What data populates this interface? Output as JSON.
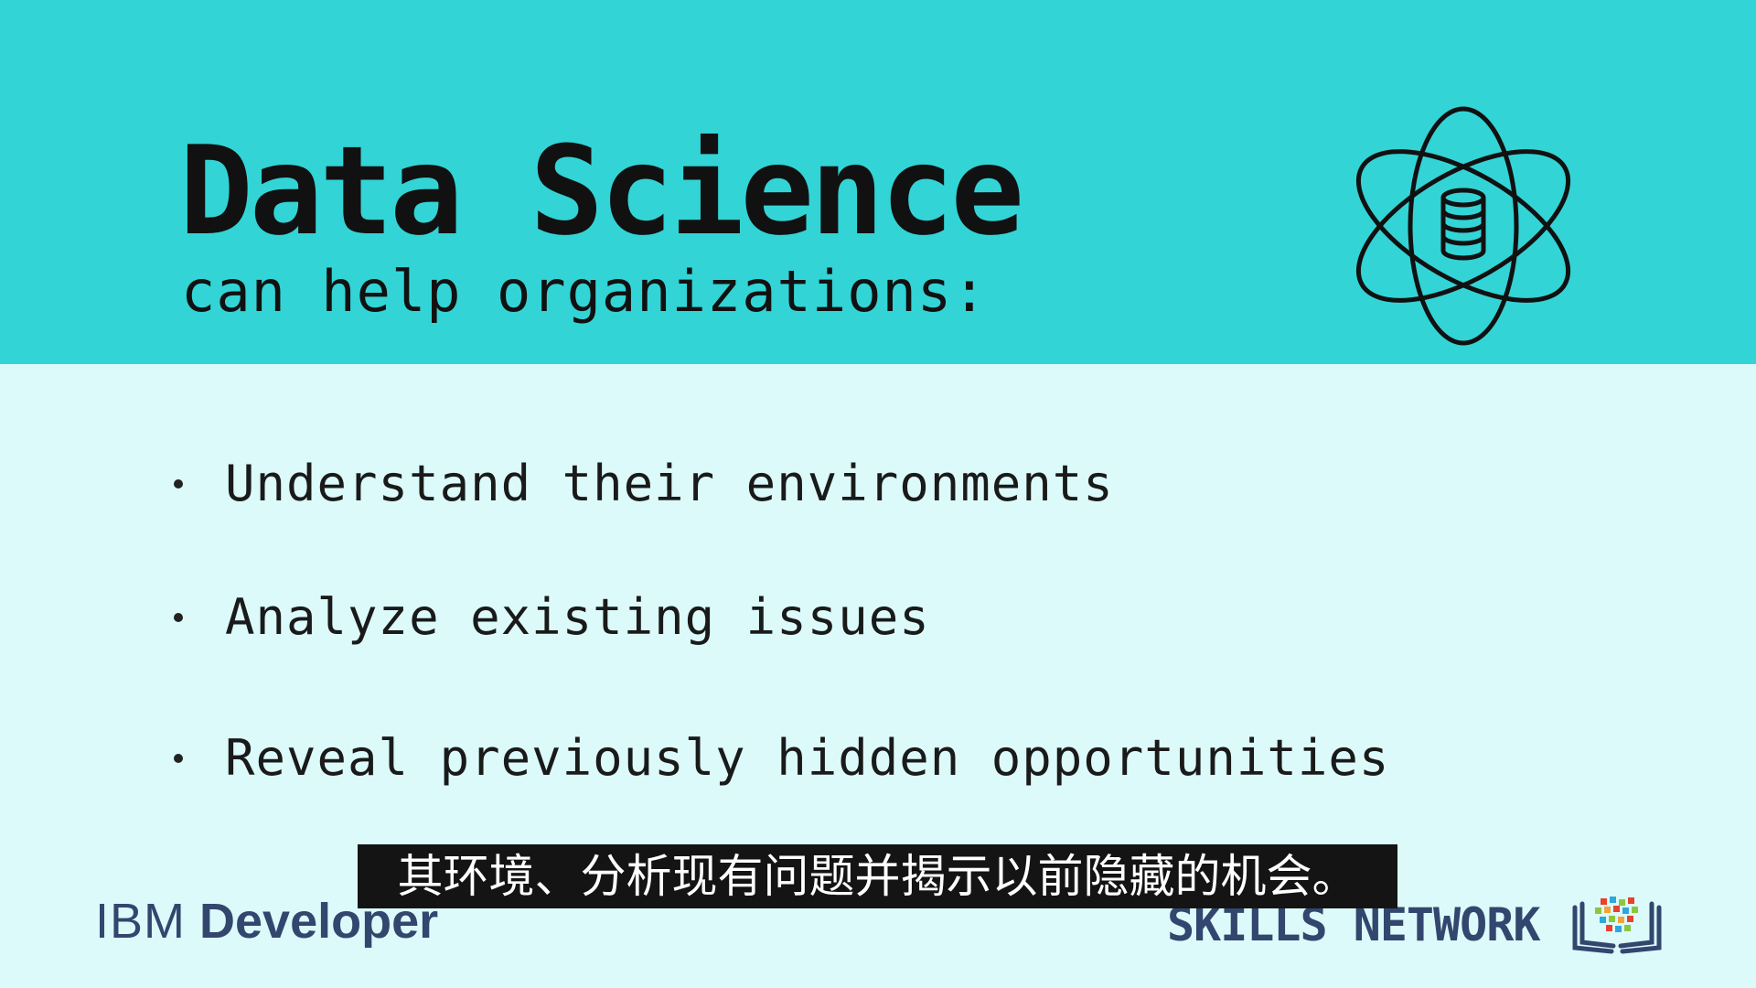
{
  "slide": {
    "title": "Data Science",
    "subtitle": "can help organizations:",
    "bullets": [
      "Understand their environments",
      "Analyze existing issues",
      "Reveal previously hidden opportunities"
    ],
    "icon": "atom-database-icon"
  },
  "caption": {
    "text": "其环境、分析现有问题并揭示以前隐藏的机会。"
  },
  "footer": {
    "ibm_logo_ibm": "IBM",
    "ibm_logo_developer": "Developer",
    "skills_network_logo": "SKILLS NETWORK",
    "skills_icon": "open-book-icon"
  },
  "colors": {
    "header_band": "#33d4d6",
    "background": "#dcfafa",
    "title_text": "#111111",
    "logo_navy": "#33466e",
    "caption_background": "#141414"
  }
}
